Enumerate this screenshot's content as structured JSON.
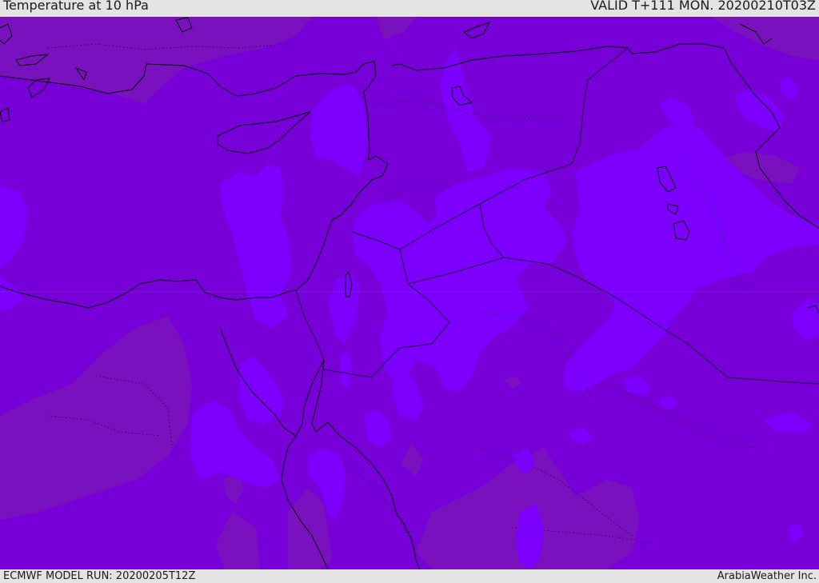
{
  "header": {
    "title": "Temperature at 10 hPa",
    "valid_time": "VALID T+111 MON. 20200210T03Z"
  },
  "footer": {
    "model_run": "ECMWF MODEL RUN: 20200205T12Z",
    "credit": "ArabiaWeather Inc."
  },
  "map": {
    "region": "Eastern Mediterranean / Middle East",
    "field": "Temperature at 10 hPa",
    "colors": {
      "base": "#7700d8",
      "warmer": "#7a11bf",
      "colder": "#7d00ff",
      "coastline": "#000000",
      "border": "#1a0030",
      "frame": "#e4e4e4"
    }
  }
}
